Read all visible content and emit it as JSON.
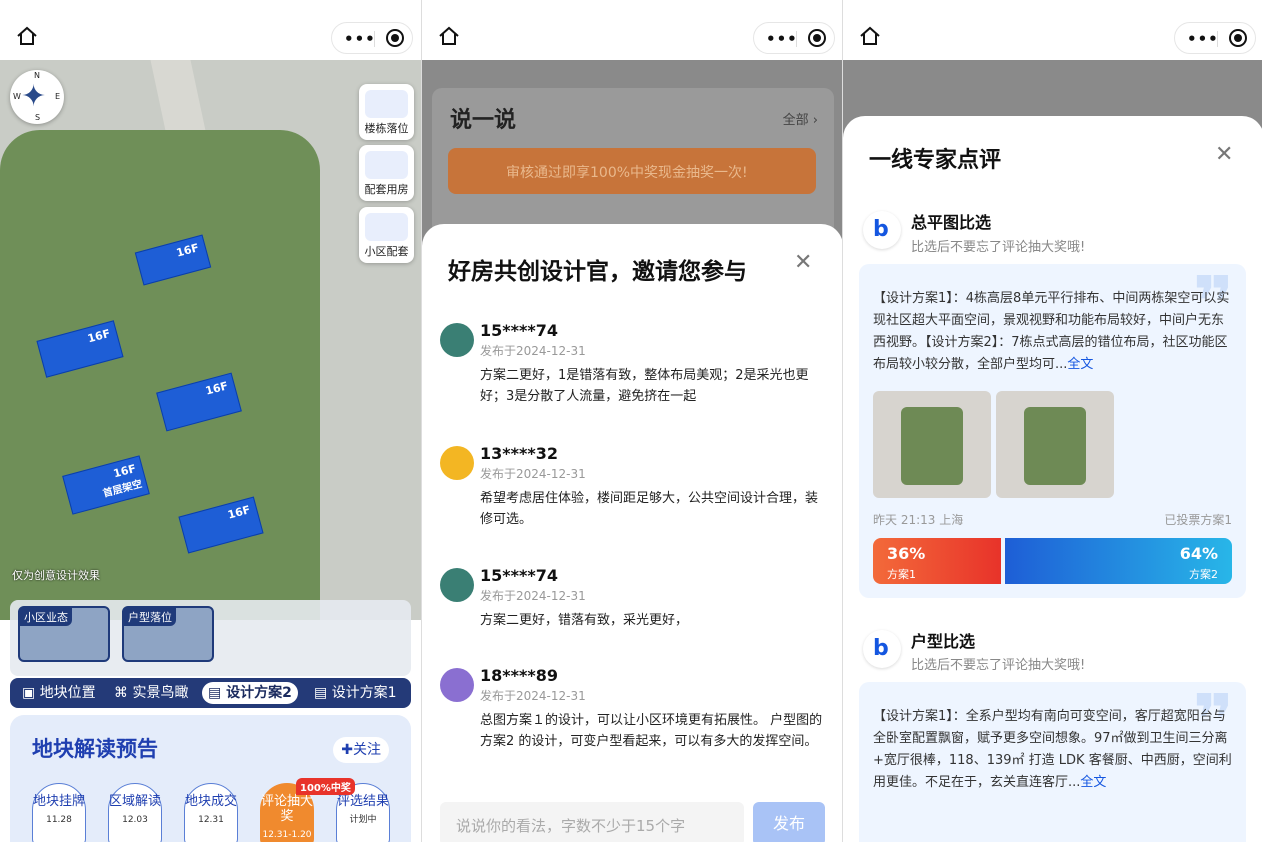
{
  "panel1": {
    "compass": {
      "n": "N",
      "s": "S",
      "e": "E",
      "w": "W"
    },
    "map_buttons": [
      "楼栋落位",
      "配套用房",
      "小区配套"
    ],
    "towers": [
      "16F",
      "16F",
      "16F",
      "16F",
      "16F"
    ],
    "tower_note": "首层架空",
    "caption": "仅为创意设计效果",
    "thumbs": [
      "小区业态",
      "户型落位"
    ],
    "tabs": [
      "地块位置",
      "实景鸟瞰",
      "设计方案2",
      "设计方案1"
    ],
    "card": {
      "title": "地块解读预告",
      "follow": "关注",
      "badge": "100%中奖",
      "steps": [
        {
          "label": "地块挂牌",
          "date": "11.28"
        },
        {
          "label": "区域解读",
          "date": "12.03"
        },
        {
          "label": "地块成交",
          "date": "12.31"
        },
        {
          "label": "评论抽大奖",
          "date": "12.31-1.20"
        },
        {
          "label": "评选结果",
          "date": "计划中"
        }
      ]
    }
  },
  "panel2": {
    "bg": {
      "title": "说一说",
      "all": "全部",
      "banner": "审核通过即享100%中奖现金抽奖一次!"
    },
    "sheet_title": "好房共创设计官，邀请您参与",
    "comments": [
      {
        "name": "15****74",
        "date": "发布于2024-12-31",
        "text": "方案二更好，1是错落有致，整体布局美观；2是采光也更好；3是分散了人流量，避免挤在一起",
        "color": "#3a7f74"
      },
      {
        "name": "13****32",
        "date": "发布于2024-12-31",
        "text": "希望考虑居住体验，楼间距足够大，公共空间设计合理，装修可选。",
        "color": "#f3b623"
      },
      {
        "name": "15****74",
        "date": "发布于2024-12-31",
        "text": "方案二更好，错落有致，采光更好，",
        "color": "#3a7f74"
      },
      {
        "name": "18****89",
        "date": "发布于2024-12-31",
        "text": "总图方案１的设计，可以让小区环境更有拓展性。 户型图的方案2 的设计，可变户型看起来，可以有多大的发挥空间。",
        "color": "#8a6fd1"
      }
    ],
    "input_placeholder": "说说你的看法，字数不少于15个字",
    "send": "发布"
  },
  "panel3": {
    "sheet_title": "一线专家点评",
    "sections": [
      {
        "title": "总平图比选",
        "sub": "比选后不要忘了评论抽大奖哦!",
        "text": "【设计方案1】：4栋高层8单元平行排布、中间两栋架空可以实现社区超大平面空间，景观视野和功能布局较好，中间户无东西视野。【设计方案2】：7栋点式高层的错位布局，社区功能区布局较小较分散，全部户型均可...",
        "more": "全文",
        "time": "昨天  21:13  上海",
        "voted": "已投票方案1",
        "vote": [
          {
            "pct": "36%",
            "label": "方案1",
            "value": 36
          },
          {
            "pct": "64%",
            "label": "方案2",
            "value": 64
          }
        ]
      },
      {
        "title": "户型比选",
        "sub": "比选后不要忘了评论抽大奖哦!",
        "text": "【设计方案1】：全系户型均有南向可变空间，客厅超宽阳台与全卧室配置飘窗，赋予更多空间想象。97㎡做到卫生间三分离+宽厅很棒，118、139㎡ 打造 LDK 客餐厨、中西厨，空间利用更佳。不足在于，玄关直连客厅...",
        "more": "全文"
      }
    ]
  }
}
